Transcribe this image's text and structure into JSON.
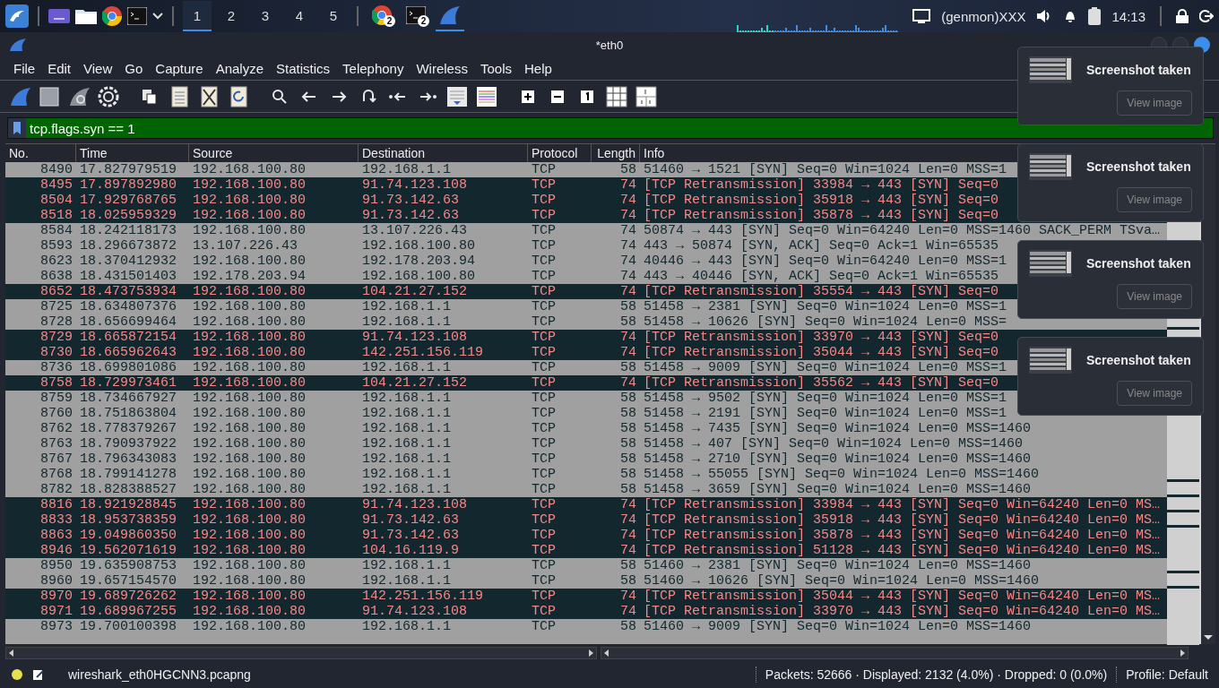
{
  "taskbar": {
    "launchers": [
      {
        "kind": "menu"
      },
      {
        "kind": "desktop"
      },
      {
        "kind": "folder"
      },
      {
        "kind": "browser"
      },
      {
        "kind": "terminal"
      },
      {
        "kind": "caret"
      }
    ],
    "workspaces": [
      {
        "label": "1",
        "selected": true
      },
      {
        "label": "2",
        "selected": false
      },
      {
        "label": "3",
        "selected": false
      },
      {
        "label": "4",
        "selected": false
      },
      {
        "label": "5",
        "selected": false
      }
    ],
    "tasks": [
      {
        "kind": "browser",
        "badge": "2",
        "selected": false
      },
      {
        "kind": "terminal",
        "badge": "2",
        "selected": false
      },
      {
        "kind": "shark",
        "selected": true
      }
    ],
    "genmon": "(genmon)XXX",
    "clock": "14:13"
  },
  "window": {
    "title": "*eth0"
  },
  "menu": [
    "File",
    "Edit",
    "View",
    "Go",
    "Capture",
    "Analyze",
    "Statistics",
    "Telephony",
    "Wireless",
    "Tools",
    "Help"
  ],
  "filter": {
    "value": "tcp.flags.syn == 1"
  },
  "packet_list": {
    "columns": [
      "No.",
      "Time",
      "Source",
      "Destination",
      "Protocol",
      "Length",
      "Info"
    ],
    "rows": [
      {
        "no": "8490",
        "time": "17.827979519",
        "source": "192.168.100.80",
        "destination": "192.168.1.1",
        "protocol": "TCP",
        "length": "58",
        "info": "51460 → 1521 [SYN] Seq=0 Win=1024 Len=0 MSS=1",
        "kind": "syn"
      },
      {
        "no": "8495",
        "time": "17.897892980",
        "source": "192.168.100.80",
        "destination": "91.74.123.108",
        "protocol": "TCP",
        "length": "74",
        "info": "[TCP Retransmission] 33984 → 443 [SYN] Seq=0",
        "kind": "bad"
      },
      {
        "no": "8504",
        "time": "17.929768765",
        "source": "192.168.100.80",
        "destination": "91.73.142.63",
        "protocol": "TCP",
        "length": "74",
        "info": "[TCP Retransmission] 35918 → 443 [SYN] Seq=0",
        "kind": "bad"
      },
      {
        "no": "8518",
        "time": "18.025959329",
        "source": "192.168.100.80",
        "destination": "91.73.142.63",
        "protocol": "TCP",
        "length": "74",
        "info": "[TCP Retransmission] 35878 → 443 [SYN] Seq=0",
        "kind": "bad"
      },
      {
        "no": "8584",
        "time": "18.242118173",
        "source": "192.168.100.80",
        "destination": "13.107.226.43",
        "protocol": "TCP",
        "length": "74",
        "info": "50874 → 443 [SYN] Seq=0 Win=64240 Len=0 MSS=1460 SACK_PERM TSva…",
        "kind": "syn"
      },
      {
        "no": "8593",
        "time": "18.296673872",
        "source": "13.107.226.43",
        "destination": "192.168.100.80",
        "protocol": "TCP",
        "length": "74",
        "info": "443 → 50874 [SYN, ACK] Seq=0 Ack=1 Win=65535",
        "kind": "syn"
      },
      {
        "no": "8623",
        "time": "18.370412932",
        "source": "192.168.100.80",
        "destination": "192.178.203.94",
        "protocol": "TCP",
        "length": "74",
        "info": "40446 → 443 [SYN] Seq=0 Win=64240 Len=0 MSS=1",
        "kind": "syn"
      },
      {
        "no": "8638",
        "time": "18.431501403",
        "source": "192.178.203.94",
        "destination": "192.168.100.80",
        "protocol": "TCP",
        "length": "74",
        "info": "443 → 40446 [SYN, ACK] Seq=0 Ack=1 Win=65535",
        "kind": "syn"
      },
      {
        "no": "8652",
        "time": "18.473753934",
        "source": "192.168.100.80",
        "destination": "104.21.27.152",
        "protocol": "TCP",
        "length": "74",
        "info": "[TCP Retransmission] 35554 → 443 [SYN] Seq=0",
        "kind": "bad"
      },
      {
        "no": "8725",
        "time": "18.634807376",
        "source": "192.168.100.80",
        "destination": "192.168.1.1",
        "protocol": "TCP",
        "length": "58",
        "info": "51458 → 2381 [SYN] Seq=0 Win=1024 Len=0 MSS=1",
        "kind": "syn"
      },
      {
        "no": "8728",
        "time": "18.656699464",
        "source": "192.168.100.80",
        "destination": "192.168.1.1",
        "protocol": "TCP",
        "length": "58",
        "info": "51458 → 10626 [SYN] Seq=0 Win=1024 Len=0 MSS=",
        "kind": "syn"
      },
      {
        "no": "8729",
        "time": "18.665872154",
        "source": "192.168.100.80",
        "destination": "91.74.123.108",
        "protocol": "TCP",
        "length": "74",
        "info": "[TCP Retransmission] 33970 → 443 [SYN] Seq=0",
        "kind": "bad"
      },
      {
        "no": "8730",
        "time": "18.665962643",
        "source": "192.168.100.80",
        "destination": "142.251.156.119",
        "protocol": "TCP",
        "length": "74",
        "info": "[TCP Retransmission] 35044 → 443 [SYN] Seq=0",
        "kind": "bad"
      },
      {
        "no": "8736",
        "time": "18.699801086",
        "source": "192.168.100.80",
        "destination": "192.168.1.1",
        "protocol": "TCP",
        "length": "58",
        "info": "51458 → 9009 [SYN] Seq=0 Win=1024 Len=0 MSS=1",
        "kind": "syn"
      },
      {
        "no": "8758",
        "time": "18.729973461",
        "source": "192.168.100.80",
        "destination": "104.21.27.152",
        "protocol": "TCP",
        "length": "74",
        "info": "[TCP Retransmission] 35562 → 443 [SYN] Seq=0",
        "kind": "bad"
      },
      {
        "no": "8759",
        "time": "18.734667927",
        "source": "192.168.100.80",
        "destination": "192.168.1.1",
        "protocol": "TCP",
        "length": "58",
        "info": "51458 → 9502 [SYN] Seq=0 Win=1024 Len=0 MSS=1",
        "kind": "syn"
      },
      {
        "no": "8760",
        "time": "18.751863804",
        "source": "192.168.100.80",
        "destination": "192.168.1.1",
        "protocol": "TCP",
        "length": "58",
        "info": "51458 → 2191 [SYN] Seq=0 Win=1024 Len=0 MSS=1",
        "kind": "syn"
      },
      {
        "no": "8762",
        "time": "18.778379267",
        "source": "192.168.100.80",
        "destination": "192.168.1.1",
        "protocol": "TCP",
        "length": "58",
        "info": "51458 → 7435 [SYN] Seq=0 Win=1024 Len=0 MSS=1460",
        "kind": "syn"
      },
      {
        "no": "8763",
        "time": "18.790937922",
        "source": "192.168.100.80",
        "destination": "192.168.1.1",
        "protocol": "TCP",
        "length": "58",
        "info": "51458 → 407 [SYN] Seq=0 Win=1024 Len=0 MSS=1460",
        "kind": "syn"
      },
      {
        "no": "8767",
        "time": "18.796343083",
        "source": "192.168.100.80",
        "destination": "192.168.1.1",
        "protocol": "TCP",
        "length": "58",
        "info": "51458 → 2710 [SYN] Seq=0 Win=1024 Len=0 MSS=1460",
        "kind": "syn"
      },
      {
        "no": "8768",
        "time": "18.799141278",
        "source": "192.168.100.80",
        "destination": "192.168.1.1",
        "protocol": "TCP",
        "length": "58",
        "info": "51458 → 55055 [SYN] Seq=0 Win=1024 Len=0 MSS=1460",
        "kind": "syn"
      },
      {
        "no": "8782",
        "time": "18.828388527",
        "source": "192.168.100.80",
        "destination": "192.168.1.1",
        "protocol": "TCP",
        "length": "58",
        "info": "51458 → 3659 [SYN] Seq=0 Win=1024 Len=0 MSS=1460",
        "kind": "syn"
      },
      {
        "no": "8816",
        "time": "18.921928845",
        "source": "192.168.100.80",
        "destination": "91.74.123.108",
        "protocol": "TCP",
        "length": "74",
        "info": "[TCP Retransmission] 33984 → 443 [SYN] Seq=0 Win=64240 Len=0 MS…",
        "kind": "bad"
      },
      {
        "no": "8833",
        "time": "18.953738359",
        "source": "192.168.100.80",
        "destination": "91.73.142.63",
        "protocol": "TCP",
        "length": "74",
        "info": "[TCP Retransmission] 35918 → 443 [SYN] Seq=0 Win=64240 Len=0 MS…",
        "kind": "bad"
      },
      {
        "no": "8863",
        "time": "19.049860350",
        "source": "192.168.100.80",
        "destination": "91.73.142.63",
        "protocol": "TCP",
        "length": "74",
        "info": "[TCP Retransmission] 35878 → 443 [SYN] Seq=0 Win=64240 Len=0 MS…",
        "kind": "bad"
      },
      {
        "no": "8946",
        "time": "19.562071619",
        "source": "192.168.100.80",
        "destination": "104.16.119.9",
        "protocol": "TCP",
        "length": "74",
        "info": "[TCP Retransmission] 51128 → 443 [SYN] Seq=0 Win=64240 Len=0 MS…",
        "kind": "bad"
      },
      {
        "no": "8950",
        "time": "19.635908753",
        "source": "192.168.100.80",
        "destination": "192.168.1.1",
        "protocol": "TCP",
        "length": "58",
        "info": "51460 → 2381 [SYN] Seq=0 Win=1024 Len=0 MSS=1460",
        "kind": "syn"
      },
      {
        "no": "8960",
        "time": "19.657154570",
        "source": "192.168.100.80",
        "destination": "192.168.1.1",
        "protocol": "TCP",
        "length": "58",
        "info": "51460 → 10626 [SYN] Seq=0 Win=1024 Len=0 MSS=1460",
        "kind": "syn"
      },
      {
        "no": "8970",
        "time": "19.689726262",
        "source": "192.168.100.80",
        "destination": "142.251.156.119",
        "protocol": "TCP",
        "length": "74",
        "info": "[TCP Retransmission] 35044 → 443 [SYN] Seq=0 Win=64240 Len=0 MS…",
        "kind": "bad"
      },
      {
        "no": "8971",
        "time": "19.689967255",
        "source": "192.168.100.80",
        "destination": "91.74.123.108",
        "protocol": "TCP",
        "length": "74",
        "info": "[TCP Retransmission] 33970 → 443 [SYN] Seq=0 Win=64240 Len=0 MS…",
        "kind": "bad"
      },
      {
        "no": "8973",
        "time": "19.700100398",
        "source": "192.168.100.80",
        "destination": "192.168.1.1",
        "protocol": "TCP",
        "length": "58",
        "info": "51460 → 9009 [SYN] Seq=0 Win=1024 Len=0 MSS=1460",
        "kind": "syn"
      }
    ]
  },
  "status_bar": {
    "file": "wireshark_eth0HGCNN3.pcapng",
    "packets": "Packets: 52666 · Displayed: 2132 (4.0%) · Dropped: 0 (0.0%)",
    "profile": "Profile: Default"
  },
  "notifications": [
    {
      "title": "Screenshot taken",
      "button": "View image"
    },
    {
      "title": "Screenshot taken",
      "button": "View image"
    },
    {
      "title": "Screenshot taken",
      "button": "View image"
    },
    {
      "title": "Screenshot taken",
      "button": "View image"
    }
  ]
}
